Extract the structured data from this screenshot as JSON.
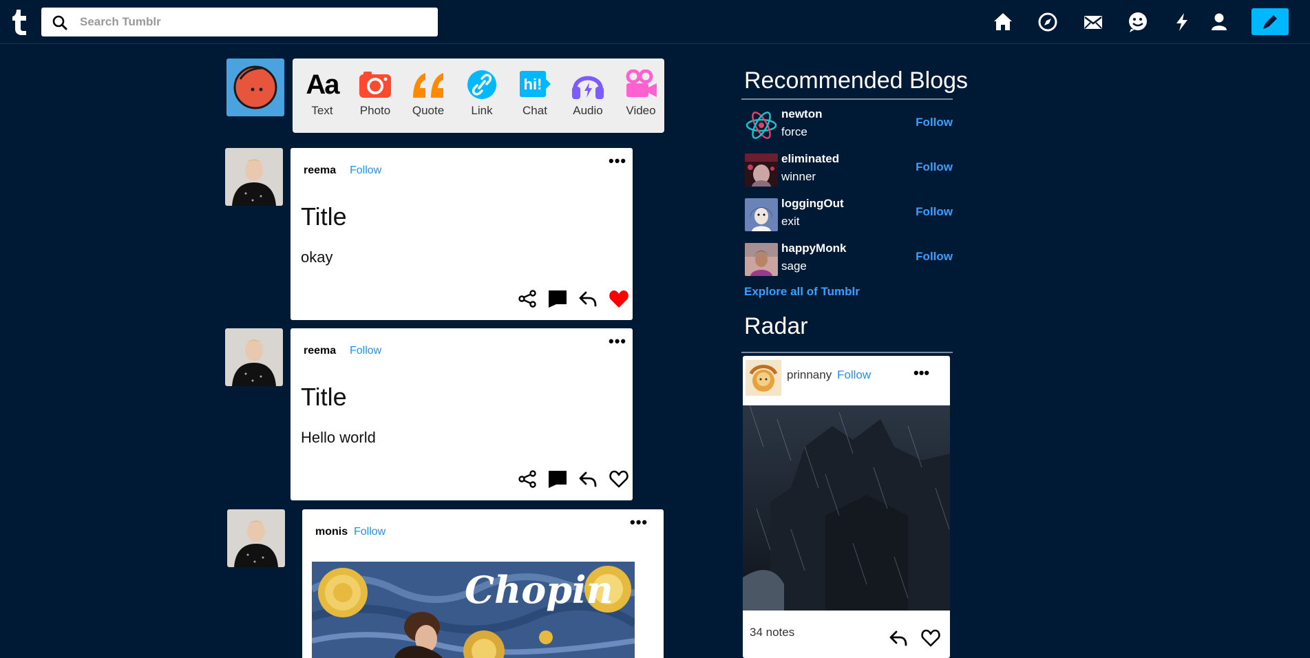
{
  "header": {
    "search_placeholder": "Search Tumblr",
    "nav_icons": [
      "home-icon",
      "explore-icon",
      "inbox-icon",
      "messages-icon",
      "activity-icon",
      "account-icon"
    ],
    "compose_icon": "pencil-icon"
  },
  "post_types": [
    {
      "label": "Text",
      "icon": "text-icon",
      "color": "#000000"
    },
    {
      "label": "Photo",
      "icon": "camera-icon",
      "color": "#ff492f"
    },
    {
      "label": "Quote",
      "icon": "quote-icon",
      "color": "#ff8a00"
    },
    {
      "label": "Link",
      "icon": "link-icon",
      "color": "#00cf35"
    },
    {
      "label": "Chat",
      "icon": "chat-icon",
      "color": "#00b8ff"
    },
    {
      "label": "Audio",
      "icon": "headphones-icon",
      "color": "#7c5cff"
    },
    {
      "label": "Video",
      "icon": "video-icon",
      "color": "#ff62ce"
    }
  ],
  "posts": [
    {
      "blog": "reema",
      "follow": "Follow",
      "title": "Title",
      "body": "okay",
      "liked": true
    },
    {
      "blog": "reema",
      "follow": "Follow",
      "title": "Title",
      "body": "Hello world",
      "liked": false
    },
    {
      "blog": "monis",
      "follow": "Follow",
      "image_text": "Chopin"
    }
  ],
  "sidebar": {
    "recommended_title": "Recommended Blogs",
    "blogs": [
      {
        "name": "newton",
        "title": "force",
        "follow": "Follow"
      },
      {
        "name": "eliminated",
        "title": "winner",
        "follow": "Follow"
      },
      {
        "name": "loggingOut",
        "title": "exit",
        "follow": "Follow"
      },
      {
        "name": "happyMonk",
        "title": "sage",
        "follow": "Follow"
      }
    ],
    "explore": "Explore all of Tumblr",
    "radar_title": "Radar",
    "radar": {
      "blog": "prinnany",
      "follow": "Follow",
      "notes": "34 notes"
    }
  },
  "colors": {
    "background": "#001935",
    "accent": "#00b8ff",
    "link": "#1e90ff",
    "like": "#ff0000"
  }
}
